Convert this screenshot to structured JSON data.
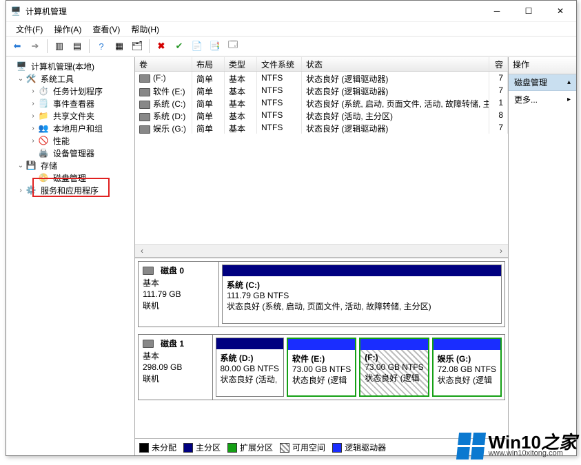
{
  "window": {
    "title": "计算机管理"
  },
  "menu": {
    "file": "文件(F)",
    "action": "操作(A)",
    "view": "查看(V)",
    "help": "帮助(H)"
  },
  "tree": {
    "root": "计算机管理(本地)",
    "systools": "系统工具",
    "sched": "任务计划程序",
    "event": "事件查看器",
    "shared": "共享文件夹",
    "users": "本地用户和组",
    "perf": "性能",
    "devmgr": "设备管理器",
    "storage": "存储",
    "diskmgmt": "磁盘管理",
    "services": "服务和应用程序"
  },
  "columns": {
    "volume": "卷",
    "layout": "布局",
    "type": "类型",
    "fs": "文件系统",
    "status": "状态",
    "cap": "容"
  },
  "volumes": [
    {
      "name": "(F:)",
      "layout": "简单",
      "type": "基本",
      "fs": "NTFS",
      "status": "状态良好 (逻辑驱动器)",
      "cap": "7"
    },
    {
      "name": "软件 (E:)",
      "layout": "简单",
      "type": "基本",
      "fs": "NTFS",
      "status": "状态良好 (逻辑驱动器)",
      "cap": "7"
    },
    {
      "name": "系统 (C:)",
      "layout": "简单",
      "type": "基本",
      "fs": "NTFS",
      "status": "状态良好 (系统, 启动, 页面文件, 活动, 故障转储, 主分区)",
      "cap": "1"
    },
    {
      "name": "系统 (D:)",
      "layout": "简单",
      "type": "基本",
      "fs": "NTFS",
      "status": "状态良好 (活动, 主分区)",
      "cap": "8"
    },
    {
      "name": "娱乐 (G:)",
      "layout": "简单",
      "type": "基本",
      "fs": "NTFS",
      "status": "状态良好 (逻辑驱动器)",
      "cap": "7"
    }
  ],
  "disks": [
    {
      "name": "磁盘 0",
      "type": "基本",
      "size": "111.79 GB",
      "state": "联机",
      "parts": [
        {
          "title": "系统  (C:)",
          "line2": "111.79 GB NTFS",
          "line3": "状态良好 (系统, 启动, 页面文件, 活动, 故障转储, 主分区)",
          "stripe": "navy",
          "green": false,
          "hatch": false
        }
      ]
    },
    {
      "name": "磁盘 1",
      "type": "基本",
      "size": "298.09 GB",
      "state": "联机",
      "parts": [
        {
          "title": "系统  (D:)",
          "line2": "80.00 GB NTFS",
          "line3": "状态良好 (活动,",
          "stripe": "navy",
          "green": false,
          "hatch": false
        },
        {
          "title": "软件  (E:)",
          "line2": "73.00 GB NTFS",
          "line3": "状态良好 (逻辑",
          "stripe": "blue",
          "green": true,
          "hatch": false
        },
        {
          "title": "(F:)",
          "line2": "73.00 GB NTFS",
          "line3": "状态良好 (逻辑",
          "stripe": "blue",
          "green": true,
          "hatch": true
        },
        {
          "title": "娱乐  (G:)",
          "line2": "72.08 GB NTFS",
          "line3": "状态良好 (逻辑",
          "stripe": "blue",
          "green": true,
          "hatch": false
        }
      ]
    }
  ],
  "legend": {
    "unalloc": "未分配",
    "primary": "主分区",
    "extended": "扩展分区",
    "free": "可用空间",
    "logical": "逻辑驱动器"
  },
  "actions": {
    "header": "操作",
    "section": "磁盘管理",
    "more": "更多..."
  },
  "watermark": {
    "big1": "Win10",
    "big2": "之家",
    "url": "www.win10xitong.com"
  }
}
